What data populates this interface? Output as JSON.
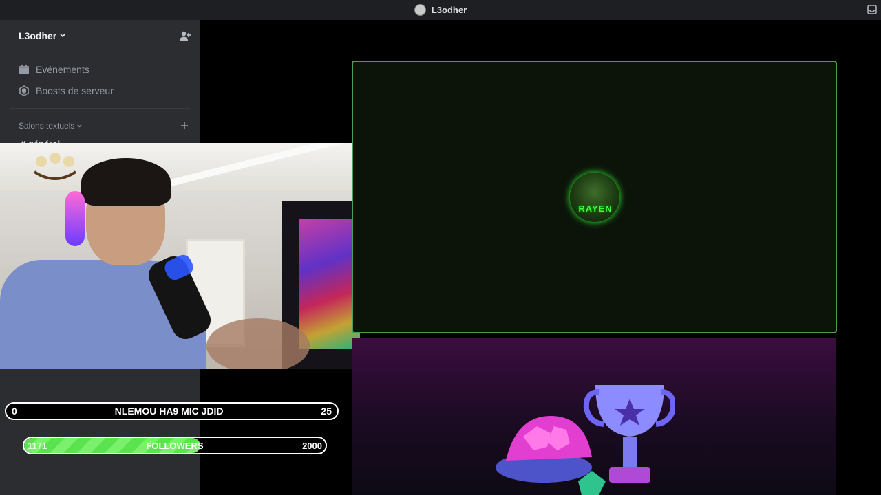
{
  "window": {
    "title": "L3odher"
  },
  "sidebar": {
    "server_name": "L3odher",
    "items": [
      {
        "label": "Événements",
        "icon": "calendar-icon"
      },
      {
        "label": "Boosts de serveur",
        "icon": "boost-icon"
      }
    ],
    "category": {
      "label": "Salons textuels"
    },
    "channel_hint": "# général"
  },
  "stream": {
    "avatar_label": "RAYEN"
  },
  "overlay": {
    "goal1": {
      "left": "0",
      "label": "NLEMOU HA9 MIC JDID",
      "right": "25"
    },
    "goal2": {
      "current": "1171",
      "label": "FOLLOWERS",
      "target": "2000",
      "progress": 0.5855
    }
  },
  "colors": {
    "accent_green": "#4d9a52",
    "progress_green": "#5be24f",
    "purple": "#3a0d3e"
  }
}
